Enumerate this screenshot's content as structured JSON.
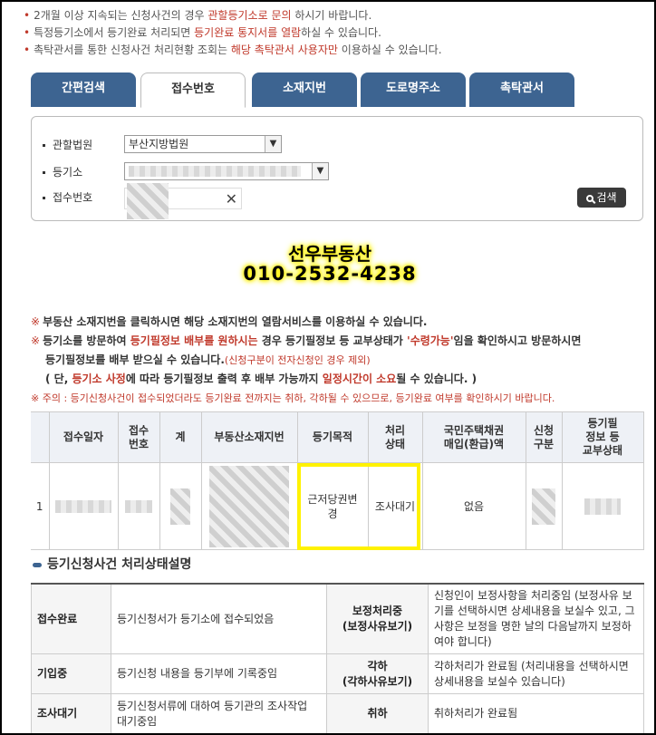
{
  "notices": [
    {
      "parts": [
        "2개월 이상 지속되는 신청사건의 경우 ",
        "관할등기소로 문의",
        " 하시기 바랍니다."
      ]
    },
    {
      "parts": [
        "특정등기소에서 등기완료 처리되면 ",
        "등기완료 통지서를 열람",
        "하실 수 있습니다."
      ]
    },
    {
      "parts": [
        "촉탁관서를 통한 신청사건 처리현황 조회는 ",
        "해당 촉탁관서 사용자만",
        " 이용하실 수 있습니다."
      ]
    }
  ],
  "tabs": [
    "간편검색",
    "접수번호",
    "소재지번",
    "도로명주소",
    "촉탁관서"
  ],
  "active_tab": 1,
  "search": {
    "court_label": "관할법원",
    "court_value": "부산지방법원",
    "registry_label": "등기소",
    "receipt_label": "접수번호",
    "search_button": "검색"
  },
  "promo": {
    "name": "선우부동산",
    "phone": "010-2532-4238"
  },
  "info": {
    "mark": "※",
    "l1": "부동산 소재지번을 클릭하시면 해당 소재지번의 열람서비스를 이용하실 수 있습니다.",
    "l2a": "등기소를 방문하여 ",
    "l2b": "등기필정보 배부를 원하시는",
    "l2c": " 경우 등기필정보 등 교부상태가 ",
    "l2d": "'수령가능'",
    "l2e": "임을 확인하시고 방문하시면",
    "l3a": "등기필정보를 배부 받으실 수 있습니다.",
    "l3b": "(신청구분이 전자신청인 경우 제외)",
    "l4a": "( 단, ",
    "l4b": "등기소 사정",
    "l4c": "에 따라 등기필정보 출력 후 배부 가능까지 ",
    "l4d": "일정시간이 소요",
    "l4e": "될 수 있습니다. )",
    "l5": "※ 주의 : 등기신청사건이 접수되었더라도 등기완료 전까지는 취하, 각하될 수 있으므로, 등기완료 여부를 확인하시기 바랍니다."
  },
  "result_table": {
    "headers": [
      "접수일자",
      "접수\n번호",
      "계",
      "부동산소재지번",
      "등기목적",
      "처리\n상태",
      "국민주택채권\n매입(환급)액",
      "신청\n구분",
      "등기필\n정보 등\n교부상태"
    ],
    "row": {
      "index": "1",
      "purpose": "근저당권변경",
      "status": "조사대기",
      "bond": "없음"
    }
  },
  "section_title": "등기신청사건 처리상태설명",
  "status_table": [
    {
      "k1": "접수완료",
      "v1": "등기신청서가 등기소에 접수되었음",
      "k2": "보정처리중\n(보정사유보기)",
      "v2": "신청인이 보정사항을 처리중임 (보정사유 보기를 선택하시면 상세내용을 보실수 있고, 그 사항은 보정을 명한 날의 다음날까지 보정하여야 합니다)"
    },
    {
      "k1": "기입중",
      "v1": "등기신청 내용을 등기부에 기록중임",
      "k2": "각하\n(각하사유보기)",
      "v2": "각하처리가 완료됨 (처리내용을 선택하시면 상세내용을 보실수 있습니다)"
    },
    {
      "k1": "조사대기",
      "v1": "등기신청서류에 대하여 등기관의 조사작업 대기중임",
      "k2": "취하",
      "v2": "취하처리가 완료됨"
    }
  ],
  "colors": {
    "tab_blue": "#3d6491",
    "highlight_yellow": "#fff200",
    "notice_red": "#c0392b"
  }
}
